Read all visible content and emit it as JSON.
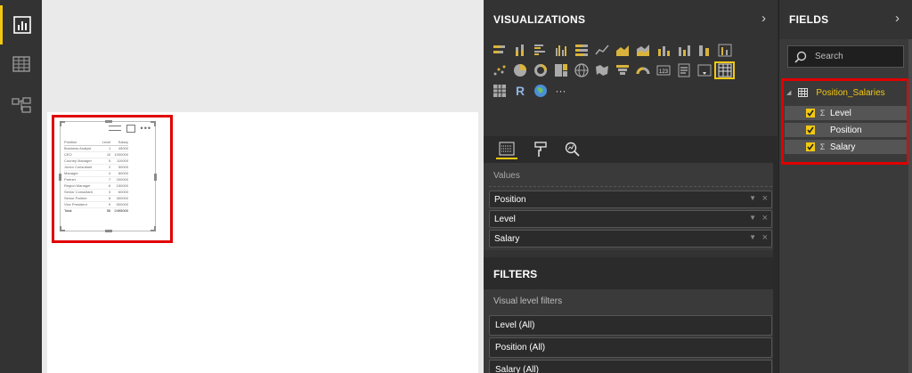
{
  "rail": {
    "items": [
      {
        "name": "report-view",
        "icon": "bar-chart-icon"
      },
      {
        "name": "data-view",
        "icon": "table-grid-icon"
      },
      {
        "name": "relationships-view",
        "icon": "relationships-icon"
      }
    ],
    "active_color": "#f2c811"
  },
  "visual": {
    "table": {
      "headers": [
        "Position",
        "Level",
        "Salary"
      ],
      "rows": [
        [
          "Business Analyst",
          "1",
          "45000"
        ],
        [
          "CEO",
          "10",
          "1000000"
        ],
        [
          "Country Manager",
          "5",
          "110000"
        ],
        [
          "Junior Consultant",
          "2",
          "50000"
        ],
        [
          "Manager",
          "4",
          "80000"
        ],
        [
          "Partner",
          "7",
          "200000"
        ],
        [
          "Region Manager",
          "6",
          "150000"
        ],
        [
          "Senior Consultant",
          "3",
          "60000"
        ],
        [
          "Senior Partner",
          "8",
          "300000"
        ],
        [
          "Vice President",
          "9",
          "500000"
        ]
      ],
      "total": [
        "Total",
        "55",
        "2495000"
      ]
    }
  },
  "visualizations": {
    "title": "VISUALIZATIONS",
    "chevron": "›",
    "gallery_more": "···",
    "values_title": "Values",
    "wells": [
      {
        "label": "Position"
      },
      {
        "label": "Level"
      },
      {
        "label": "Salary"
      }
    ],
    "well_caret": "▼",
    "well_remove": "×",
    "filters_title": "FILTERS",
    "filters_sub": "Visual level filters",
    "filters": [
      {
        "label": "Level  (All)"
      },
      {
        "label": "Position  (All)"
      },
      {
        "label": "Salary  (All)"
      }
    ]
  },
  "fields": {
    "title": "FIELDS",
    "chevron": "›",
    "search_placeholder": "Search",
    "table_name": "Position_Salaries",
    "items": [
      {
        "label": "Level",
        "sigma": "Σ"
      },
      {
        "label": "Position",
        "sigma": ""
      },
      {
        "label": "Salary",
        "sigma": "Σ"
      }
    ]
  },
  "colors": {
    "accent": "#f2c811",
    "highlight": "#e00000",
    "pane_bg": "#333333"
  }
}
